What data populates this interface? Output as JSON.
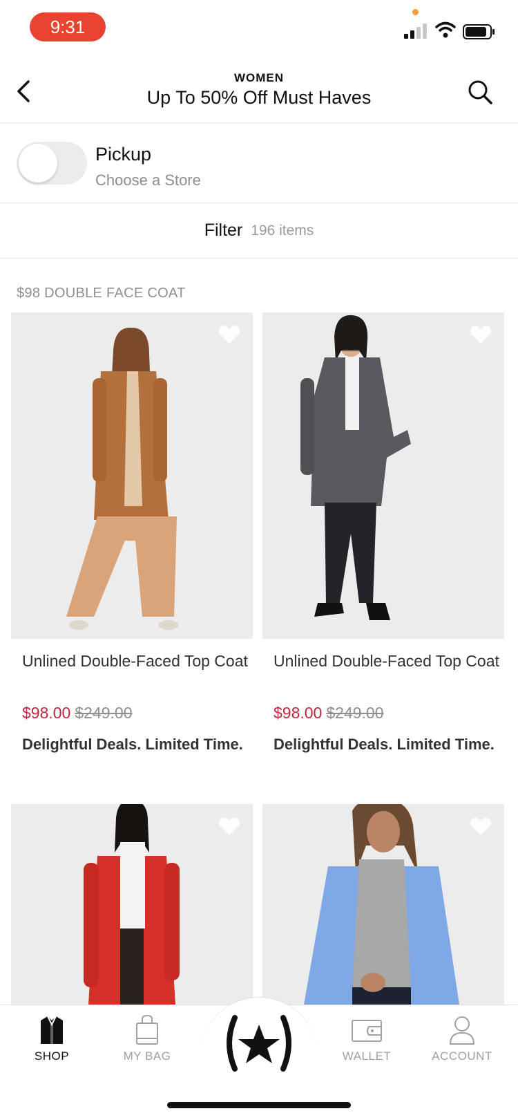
{
  "status_bar": {
    "time": "9:31"
  },
  "header": {
    "eyebrow": "WOMEN",
    "title": "Up To 50% Off Must Haves"
  },
  "pickup": {
    "label": "Pickup",
    "sublabel": "Choose a Store",
    "enabled": false
  },
  "filter": {
    "label": "Filter",
    "count": "196 items"
  },
  "section_label": "$98 DOUBLE FACE COAT",
  "products": [
    {
      "name": "Unlined Double-Faced Top Coat",
      "sale_price": "$98.00",
      "original_price": "$249.00",
      "promo": "Delightful Deals. Limited Time.",
      "coat_color": "#b4703c"
    },
    {
      "name": "Unlined Double-Faced Top Coat",
      "sale_price": "$98.00",
      "original_price": "$249.00",
      "promo": "Delightful Deals. Limited Time.",
      "coat_color": "#5a5a5e"
    },
    {
      "coat_color": "#d6302a"
    },
    {
      "coat_color": "#7fa9e6"
    }
  ],
  "tab_bar": {
    "tabs": [
      {
        "label": "SHOP",
        "icon": "shirt-icon",
        "active": true
      },
      {
        "label": "MY BAG",
        "icon": "bag-icon",
        "active": false
      },
      {
        "label": "",
        "icon": "star-rewards-icon",
        "active": false
      },
      {
        "label": "WALLET",
        "icon": "wallet-icon",
        "active": false
      },
      {
        "label": "ACCOUNT",
        "icon": "person-icon",
        "active": false
      }
    ]
  },
  "colors": {
    "time_pill": "#e8432f",
    "sale_price": "#c0263e",
    "image_background": "#ededed"
  }
}
